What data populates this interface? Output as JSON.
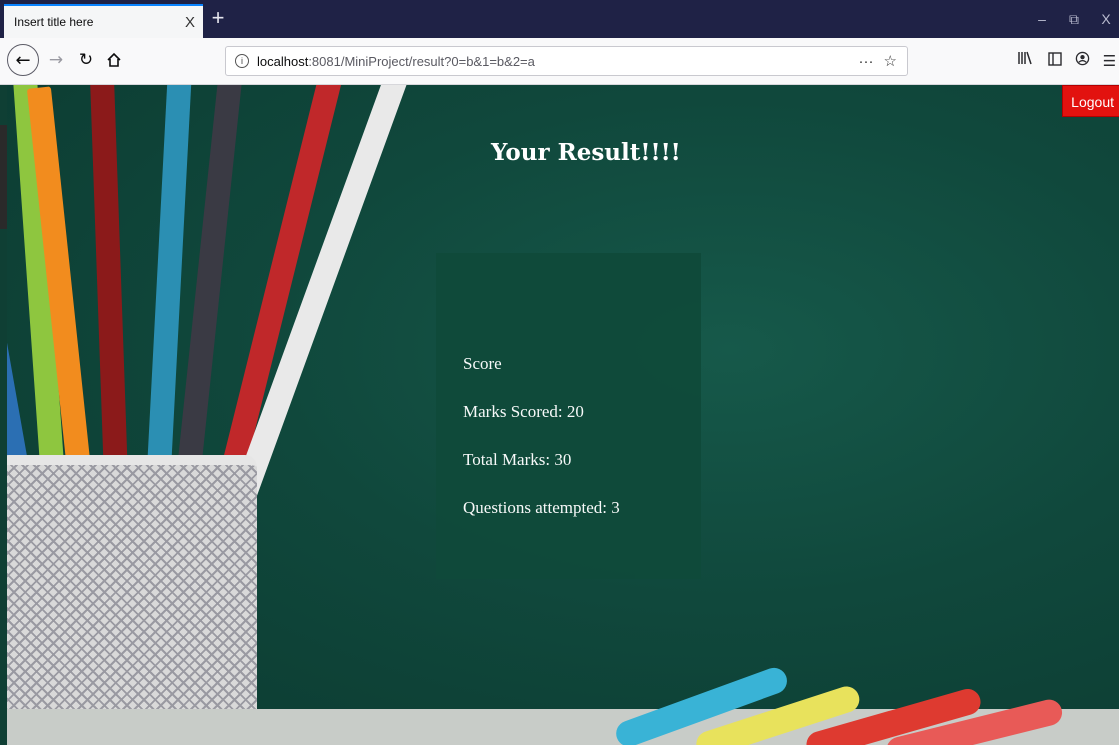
{
  "browser": {
    "tab_title": "Insert title here",
    "tab_close": "X",
    "new_tab": "+",
    "window_controls": {
      "minimize": "–",
      "restore": "⧉",
      "close": "X"
    },
    "url_host": "localhost",
    "url_rest": ":8081/MiniProject/result?0=b&1=b&2=a",
    "url_more": "···",
    "bookmark_icon": "star-icon"
  },
  "page": {
    "logout_label": "Logout",
    "title": "Your Result!!!!",
    "result": {
      "heading": "Score",
      "marks_scored": "Marks Scored: 20",
      "total_marks": "Total Marks: 30",
      "questions_attempted": "Questions attempted: 3"
    }
  },
  "colors": {
    "chalkboard": "#10483c",
    "logout_bg": "#e2120f",
    "tab_accent": "#0a84ff"
  }
}
